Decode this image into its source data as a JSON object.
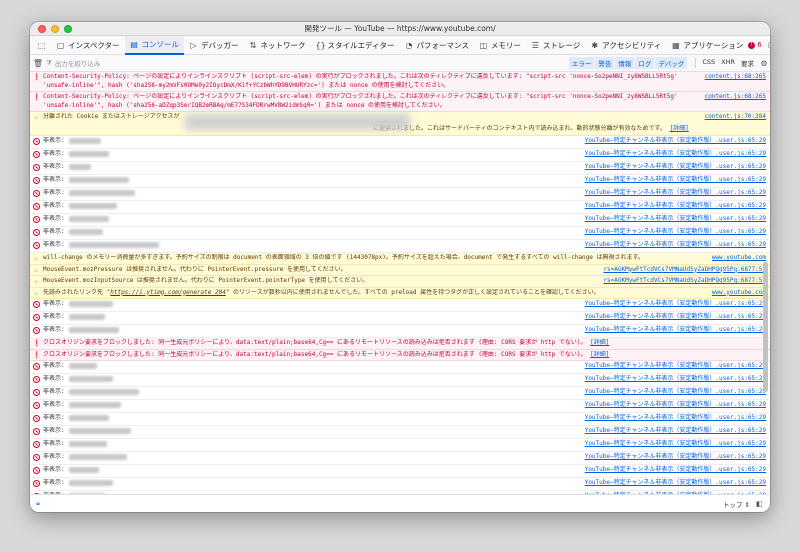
{
  "window": {
    "title": "開発ツール — YouTube — https://www.youtube.com/"
  },
  "toolbar": {
    "tools": [
      {
        "icon": "picker-icon",
        "glyph": "⬚",
        "label": ""
      },
      {
        "icon": "inspector-icon",
        "glyph": "▢",
        "label": "インスペクター"
      },
      {
        "icon": "console-icon",
        "glyph": "▤",
        "label": "コンソール"
      },
      {
        "icon": "debugger-icon",
        "glyph": "▷",
        "label": "デバッガー"
      },
      {
        "icon": "network-icon",
        "glyph": "⇅",
        "label": "ネットワーク"
      },
      {
        "icon": "style-editor-icon",
        "glyph": "{}",
        "label": "スタイルエディター"
      },
      {
        "icon": "performance-icon",
        "glyph": "◔",
        "label": "パフォーマンス"
      },
      {
        "icon": "memory-icon",
        "glyph": "◫",
        "label": "メモリー"
      },
      {
        "icon": "storage-icon",
        "glyph": "☰",
        "label": "ストレージ"
      },
      {
        "icon": "accessibility-icon",
        "glyph": "✱",
        "label": "アクセシビリティ"
      },
      {
        "icon": "application-icon",
        "glyph": "▦",
        "label": "アプリケーション"
      }
    ],
    "error_count": "6",
    "error_badge": "!"
  },
  "filter": {
    "placeholder": "出力を絞り込み",
    "levels": [
      "エラー",
      "警告",
      "情報",
      "ログ",
      "デバッグ"
    ],
    "extras": [
      "CSS",
      "XHR",
      "要求"
    ]
  },
  "log": {
    "hidden_label": "非表示:",
    "detail_label": "[詳細]",
    "src_youtube": "YouTube−特定チャンネル非表示（安定動作版）.user.js:65:29",
    "rows": [
      {
        "type": "error",
        "lines": [
          "Content-Security-Policy: ページの設定によりインラインスクリプト (script-src-elem) の実行がブロックされました。これは次のディレクティブに違反しています: \"script-src 'nonce-So2peNNI_zy8WSBLL5Rt5g'",
          "'unsafe-inline'\", hash ('sha256-my2mVFs0OMe0y2IOycDmX/Kif+YCzbWhYD9BVHURYzc=') または nonce の使用を検討してください。"
        ],
        "src": "content.js:68:265"
      },
      {
        "type": "error",
        "lines": [
          "Content-Security-Policy: ページの設定によりインラインスクリプト (script-src-elem) の実行がブロックされました。これは次のディレクティブに違反しています: \"script-src 'nonce-So2peNNI_zy8WSBLL5Rt5g'",
          "'unsafe-inline'\", hash ('sha256-aDZqp3SerIQB2eRBAq/mE77S34FDRrwMV8W2idmSq0=') または nonce の使用を検討してください。"
        ],
        "src": "content.js:68:265"
      },
      {
        "type": "warn-cookie",
        "lines": [
          "分離された Cookie またはストレージアクセスが",
          "に提供されました。これはサードパーティのコンテキスト内で読み込まれ、動的状態分離が有効なためです。"
        ],
        "src": "content.js:70:284"
      },
      {
        "type": "hidden"
      },
      {
        "type": "hidden"
      },
      {
        "type": "hidden"
      },
      {
        "type": "hidden"
      },
      {
        "type": "hidden"
      },
      {
        "type": "hidden"
      },
      {
        "type": "hidden"
      },
      {
        "type": "hidden"
      },
      {
        "type": "hidden"
      },
      {
        "type": "warn",
        "lines": [
          "will-change のメモリー消費量が多すぎます。予約サイズの制限は document の表面領域の 3 倍の値です (1443078px)。予約サイズを超えた場合、document で発生するすべての will-change は無視されます。"
        ],
        "src": "www.youtube.com"
      },
      {
        "type": "warn",
        "lines": [
          "MouseEvent.mozPressure は推奨されません。代わりに PointerEvent.pressure を使用してください。"
        ],
        "src": "rs=AGKMywFtTcdVCs7VMNaUdSyZaDHPQq95Pq:6877:51"
      },
      {
        "type": "warn",
        "lines": [
          "MouseEvent.mozInputSource は推奨されません。代わりに PointerEvent.pointerType を使用してください。"
        ],
        "src": "rs=AGKMywFtTcdVCs7VMNaUdSyZaDHPQq95Pq:6877:51"
      },
      {
        "type": "warn-link",
        "pre": "先読みされたリンク先 \"",
        "link": "https://i.ytimg.com/generate_204",
        "post": "\" のリソースが数秒以内に使用されませんでした。すべての preload 属性を持つタグが正しく設定されていることを確認してください。",
        "src": "www.youtube.com"
      },
      {
        "type": "hidden"
      },
      {
        "type": "hidden"
      },
      {
        "type": "hidden"
      },
      {
        "type": "error-cors",
        "lines": [
          "クロスオリジン要求をブロックしました: 同一生成元ポリシーにより、data:text/plain;base64,Cg== にあるリモートリソースの読み込みは拒否されます (理由: CORS 要求が http でない)。"
        ]
      },
      {
        "type": "error-cors",
        "lines": [
          "クロスオリジン要求をブロックしました: 同一生成元ポリシーにより、data:text/plain;base64,Cg== にあるリモートリソースの読み込みは拒否されます (理由: CORS 要求が http でない)。"
        ]
      },
      {
        "type": "hidden"
      },
      {
        "type": "hidden"
      },
      {
        "type": "hidden"
      },
      {
        "type": "hidden"
      },
      {
        "type": "hidden"
      },
      {
        "type": "hidden"
      },
      {
        "type": "hidden"
      },
      {
        "type": "hidden"
      },
      {
        "type": "hidden"
      },
      {
        "type": "hidden"
      },
      {
        "type": "hidden"
      },
      {
        "type": "hidden"
      },
      {
        "type": "hidden"
      },
      {
        "type": "hidden"
      }
    ]
  },
  "input": {
    "prompt": "»",
    "context": "トップ ⇕"
  },
  "colors": {
    "accent": "#0060df",
    "error": "#c50042",
    "warn_bg": "#fffbd6",
    "error_bg": "#fdf2f5"
  }
}
